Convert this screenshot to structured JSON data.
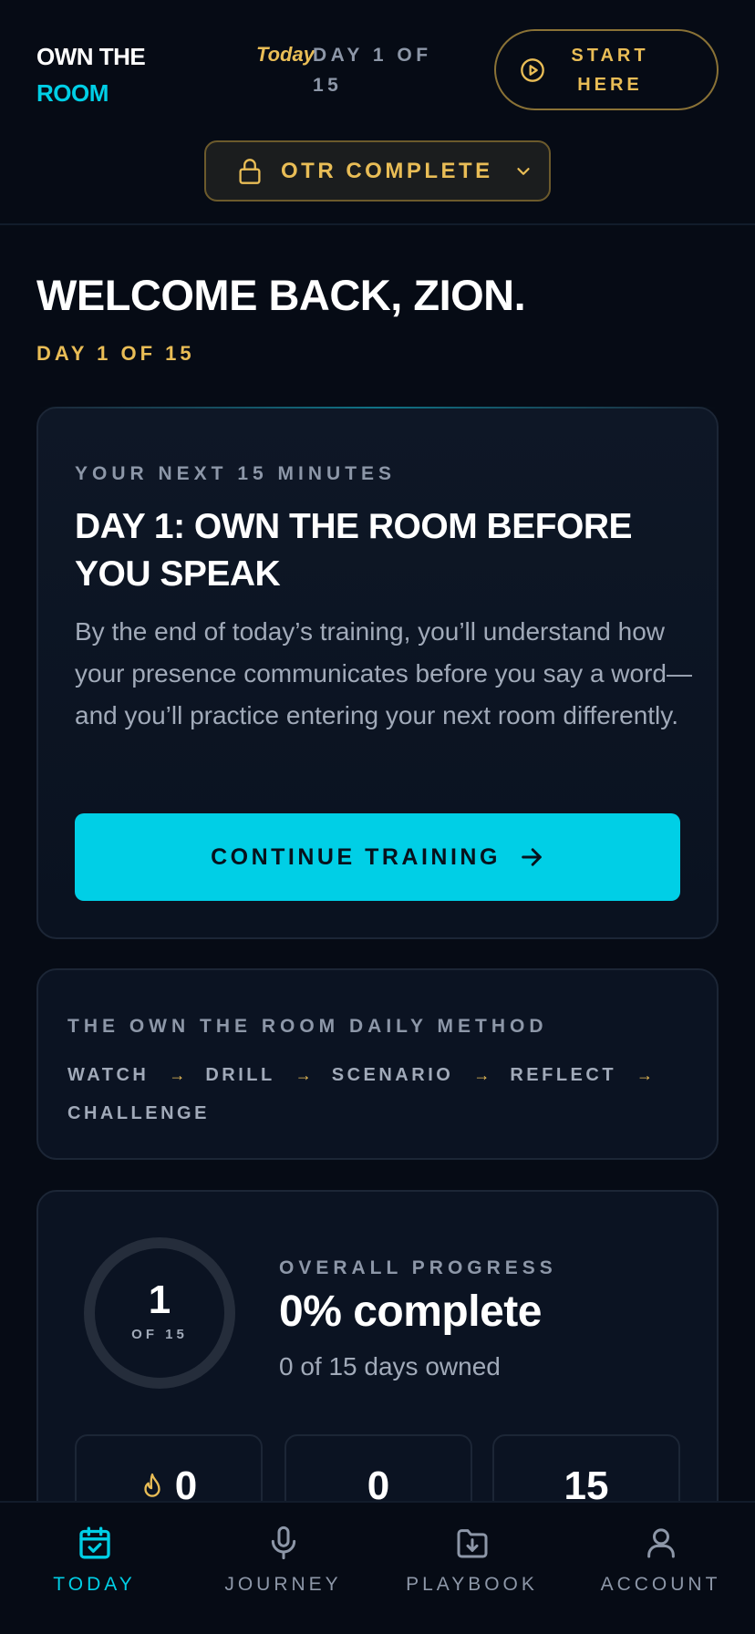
{
  "header": {
    "brand_line1": "OWN THE",
    "brand_line2": "ROOM",
    "today_label": "Today",
    "day_label": "DAY 1 OF 15",
    "start_button": "START HERE",
    "program_selector": "OTR COMPLETE"
  },
  "welcome": {
    "title": "WELCOME BACK, ZION.",
    "day": "DAY 1 OF 15"
  },
  "next_session": {
    "eyebrow": "YOUR NEXT 15 MINUTES",
    "title": "DAY 1: OWN THE ROOM BEFORE YOU SPEAK",
    "description": "By the end of today’s training, you’ll understand how your presence communicates before you say a word—and you’ll practice entering your next room differently.",
    "cta": "CONTINUE TRAINING"
  },
  "method": {
    "eyebrow": "THE OWN THE ROOM DAILY METHOD",
    "separator": "→",
    "steps": [
      "WATCH",
      "DRILL",
      "SCENARIO",
      "REFLECT",
      "CHALLENGE"
    ]
  },
  "progress": {
    "eyebrow": "OVERALL PROGRESS",
    "ring_value": "1",
    "ring_caption": "OF 15",
    "fraction_complete": 0,
    "percent_label": "0% complete",
    "days_owned": "0 of 15 days owned",
    "stats": [
      {
        "value": "0",
        "icon": "flame-icon"
      },
      {
        "value": "0"
      },
      {
        "value": "15"
      }
    ]
  },
  "nav": {
    "items": [
      {
        "label": "TODAY",
        "icon": "calendar-check-icon",
        "active": true
      },
      {
        "label": "JOURNEY",
        "icon": "microphone-icon",
        "active": false
      },
      {
        "label": "PLAYBOOK",
        "icon": "folder-download-icon",
        "active": false
      },
      {
        "label": "ACCOUNT",
        "icon": "user-icon",
        "active": false
      }
    ]
  },
  "colors": {
    "background": "#060b15",
    "accent_cyan": "#00cfe6",
    "accent_gold": "#e9bd56",
    "muted_text": "#8d97a8"
  }
}
